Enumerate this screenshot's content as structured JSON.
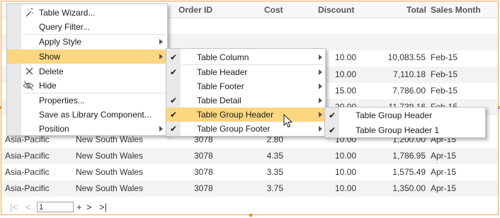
{
  "table": {
    "headers": {
      "order_id": "Order ID",
      "cost": "Cost",
      "discount": "Discount",
      "total": "Total",
      "sales_month": "Sales Month"
    },
    "partial_rows": [
      {
        "discount": "10.00",
        "total": "10,083.55",
        "month": "Feb-15"
      },
      {
        "discount": "10.00",
        "total": "7,110.18",
        "month": "Feb-15"
      },
      {
        "discount": "15.00",
        "total": "7,786.00",
        "month": "Feb-15"
      },
      {
        "discount": "20.00",
        "total": "11,739.16",
        "month": "Feb-15"
      }
    ],
    "rows": [
      {
        "region": "Asia-Pacific",
        "state": "New South Wales",
        "order_id": "3078",
        "cost": "2.80",
        "discount": "10.00",
        "total": "1,200.00",
        "month": "Apr-15"
      },
      {
        "region": "Asia-Pacific",
        "state": "New South Wales",
        "order_id": "3078",
        "cost": "4.35",
        "discount": "10.00",
        "total": "1,786.95",
        "month": "Apr-15"
      },
      {
        "region": "Asia-Pacific",
        "state": "New South Wales",
        "order_id": "3078",
        "cost": "3.35",
        "discount": "10.00",
        "total": "1,575.49",
        "month": "Apr-15"
      },
      {
        "region": "Asia-Pacific",
        "state": "New South Wales",
        "order_id": "3078",
        "cost": "3.75",
        "discount": "10.00",
        "total": "1,350.00",
        "month": "Apr-15"
      }
    ]
  },
  "pager": {
    "first": "|<",
    "prev": "<",
    "page_value": "1",
    "plus": "+",
    "next": ">",
    "last": ">|"
  },
  "context_menu": {
    "items": [
      {
        "label": "Table Wizard...",
        "icon": "wizard-wand-icon"
      },
      {
        "label": "Query Filter..."
      },
      {
        "label": "Apply Style",
        "submenu": true
      },
      {
        "label": "Show",
        "submenu": true,
        "selected": true
      },
      {
        "label": "Delete",
        "icon": "delete-x-icon"
      },
      {
        "label": "Hide",
        "icon": "hide-eye-icon"
      },
      {
        "label": "Properties..."
      },
      {
        "label": "Save as Library Component..."
      },
      {
        "label": "Position",
        "submenu": true
      }
    ]
  },
  "show_menu": {
    "items": [
      {
        "label": "Table Column",
        "checked": true,
        "submenu": true
      },
      {
        "label": "Table Header",
        "checked": true,
        "submenu": true
      },
      {
        "label": "Table Footer",
        "checked": false,
        "submenu": true
      },
      {
        "label": "Table Detail",
        "checked": true,
        "submenu": true
      },
      {
        "label": "Table Group Header",
        "checked": true,
        "submenu": true,
        "selected": true
      },
      {
        "label": "Table Group Footer",
        "checked": true,
        "submenu": true
      }
    ]
  },
  "group_header_menu": {
    "items": [
      {
        "label": "Table Group Header",
        "checked": true
      },
      {
        "label": "Table Group Header 1",
        "checked": true
      }
    ]
  },
  "colors": {
    "highlight": "#fbd782",
    "frame_border": "#f0a64a",
    "gutter": "#e9e9e9"
  }
}
